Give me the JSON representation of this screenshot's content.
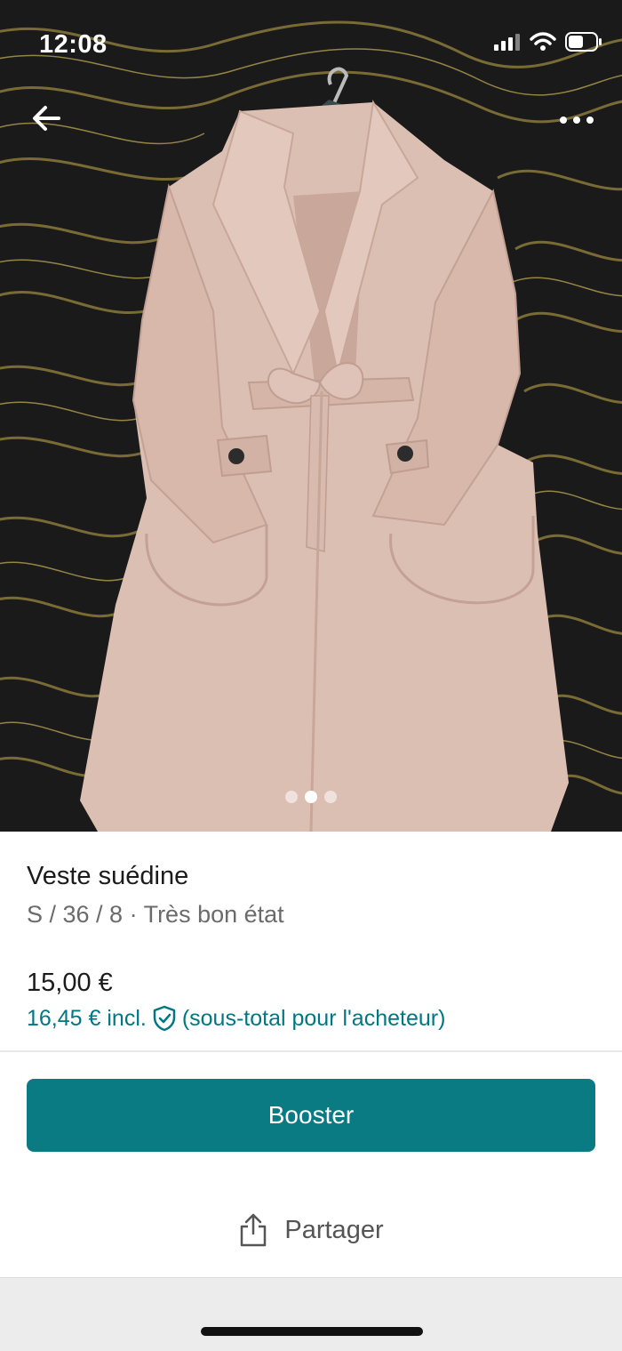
{
  "status_bar": {
    "time": "12:08"
  },
  "nav": {
    "back_icon": "arrow-left-icon",
    "more_icon": "more-horizontal-icon"
  },
  "gallery": {
    "image_count": 3,
    "active_index": 1
  },
  "item": {
    "title": "Veste suédine",
    "details": "S / 36 / 8 · Très bon état",
    "price": "15,00 €",
    "price_incl": "16,45 € incl.",
    "price_incl_note": "(sous-total pour l'acheteur)"
  },
  "actions": {
    "booster_label": "Booster",
    "share_label": "Partager"
  },
  "colors": {
    "accent": "#007782",
    "button": "#0a7b83",
    "coat": "#dcbfb3",
    "background_fabric": "#1a1a1a"
  }
}
